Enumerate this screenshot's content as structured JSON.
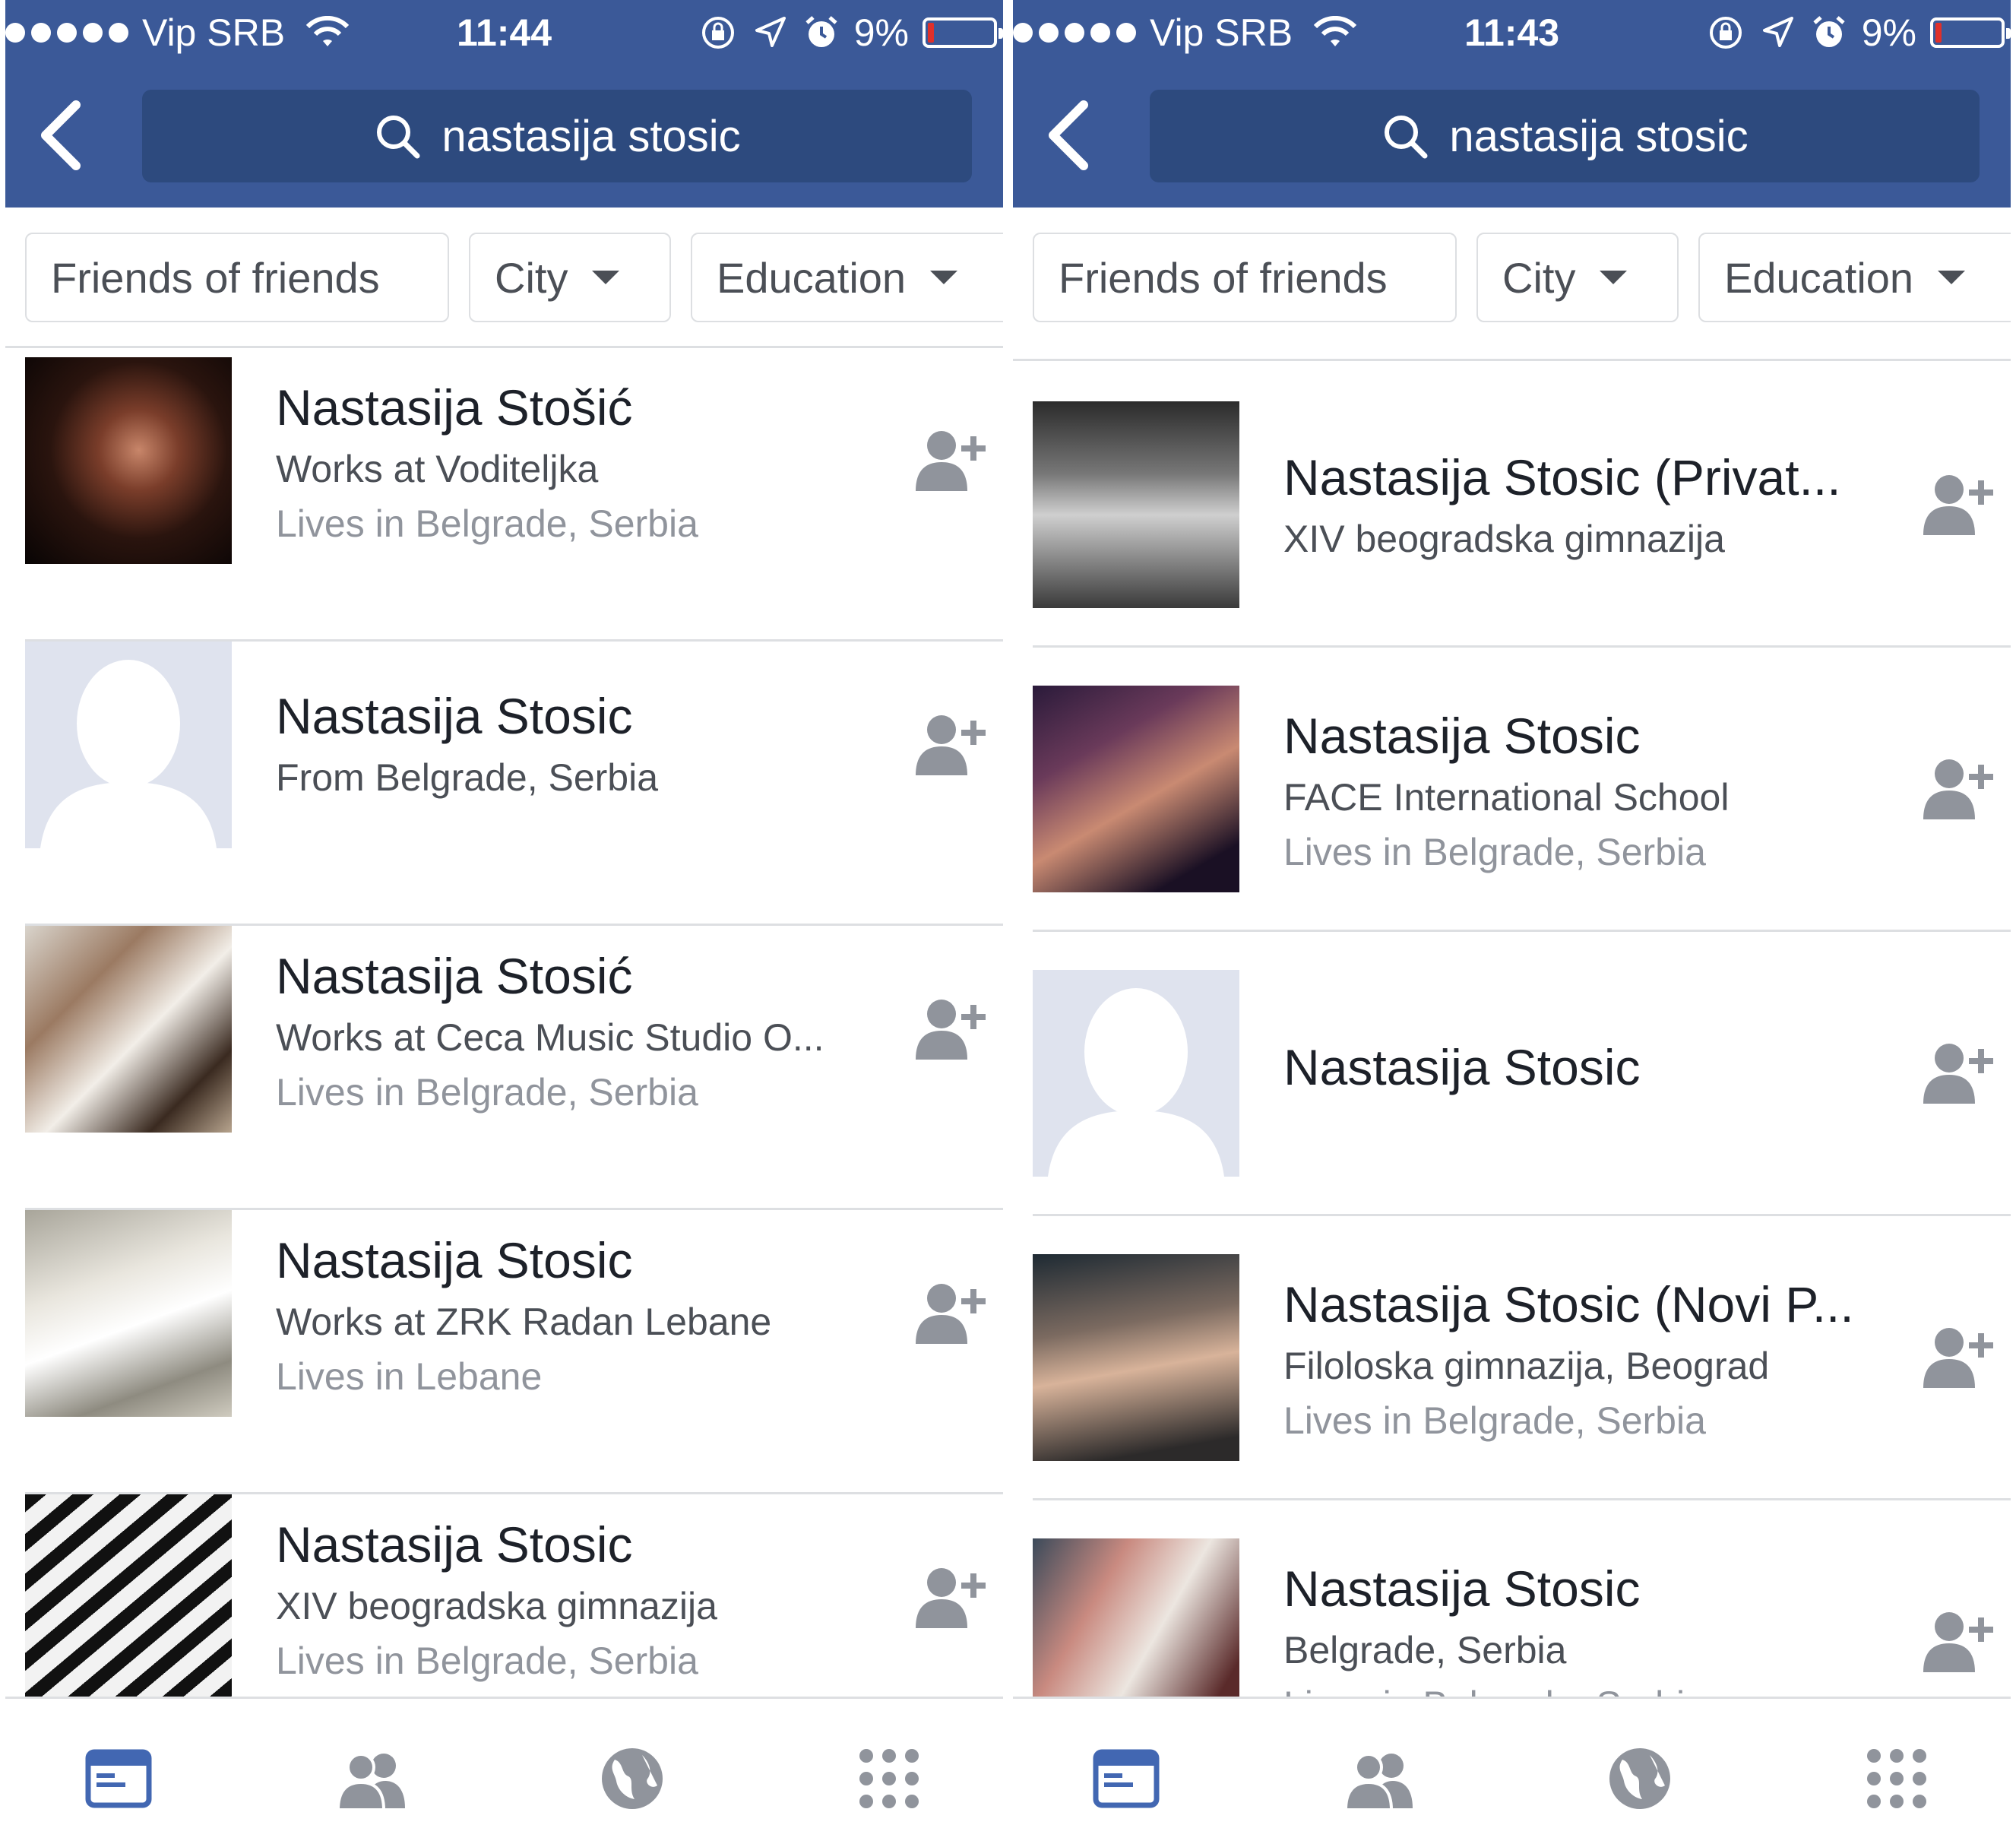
{
  "colors": {
    "header_blue": "#3b5998",
    "search_bg": "#2d4a7e",
    "icon_gray": "#90949c",
    "active_tab": "#4267b2",
    "battery_low": "#e0302a"
  },
  "screens": [
    {
      "status": {
        "carrier": "Vip SRB",
        "time": "11:44",
        "battery": "9%"
      },
      "search": {
        "query": "nastasija stosic"
      },
      "filters": {
        "friends_of_friends": "Friends of friends",
        "city": "City",
        "education": "Education"
      },
      "results": [
        {
          "name": "Nastasija Stošić",
          "line1": "Works at Voditeljka",
          "line2": "Lives in Belgrade, Serbia"
        },
        {
          "name": "Nastasija Stosic",
          "line1": "From Belgrade, Serbia",
          "line2": ""
        },
        {
          "name": "Nastasija Stosić",
          "line1": "Works at Ceca Music Studio O...",
          "line2": "Lives in Belgrade, Serbia"
        },
        {
          "name": "Nastasija Stosic",
          "line1": "Works at ZRK Radan Lebane",
          "line2": "Lives in Lebane"
        },
        {
          "name": "Nastasija Stosic",
          "line1": "XIV beogradska gimnazija",
          "line2": "Lives in Belgrade, Serbia"
        }
      ]
    },
    {
      "status": {
        "carrier": "Vip SRB",
        "time": "11:43",
        "battery": "9%"
      },
      "search": {
        "query": "nastasija stosic"
      },
      "filters": {
        "friends_of_friends": "Friends of friends",
        "city": "City",
        "education": "Education"
      },
      "results": [
        {
          "name": "Nastasija Stosic (Privat...",
          "line1": "XIV beogradska gimnazija",
          "line2": ""
        },
        {
          "name": "Nastasija Stosic",
          "line1": "FACE International School",
          "line2": "Lives in Belgrade, Serbia"
        },
        {
          "name": "Nastasija Stosic",
          "line1": "",
          "line2": ""
        },
        {
          "name": "Nastasija Stosic (Novi P...",
          "line1": "Filoloska gimnazija, Beograd",
          "line2": "Lives in Belgrade, Serbia"
        },
        {
          "name": "Nastasija Stosic",
          "line1": "Belgrade, Serbia",
          "line2": "Lives in Belgrade, Serbia"
        }
      ]
    }
  ],
  "tabs": [
    "news-feed-icon",
    "friends-icon",
    "globe-icon",
    "menu-grid-icon"
  ]
}
